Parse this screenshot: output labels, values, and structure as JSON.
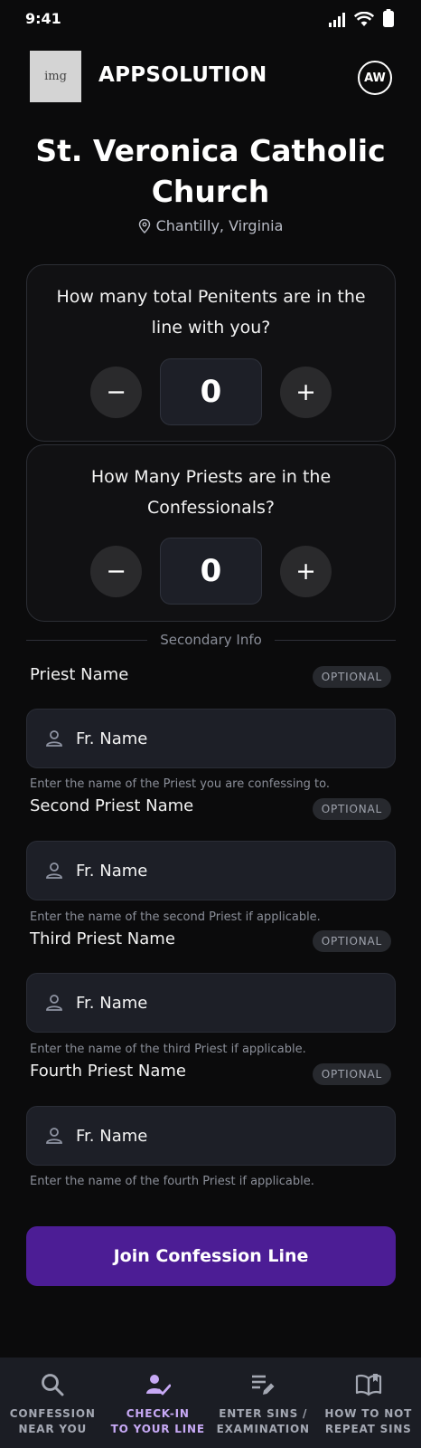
{
  "status_bar": {
    "time": "9:41"
  },
  "header": {
    "logo_text": "img",
    "app_name": "APPSOLUTION",
    "avatar_initials": "AW"
  },
  "church": {
    "name_line1": "St. Veronica Catholic",
    "name_line2": "Church",
    "location": "Chantilly, Virginia"
  },
  "penitents": {
    "question_line1": "How many total Penitents are in the",
    "question_line2": "line with you?",
    "value": "0",
    "minus": "−",
    "plus": "+"
  },
  "priests": {
    "question_line1": "How Many Priests are in the",
    "question_line2": "Confessionals?",
    "value": "0",
    "minus": "−",
    "plus": "+"
  },
  "secondary": {
    "label": "Secondary Info"
  },
  "fields": [
    {
      "label": "Priest Name",
      "badge": "OPTIONAL",
      "placeholder": "Fr. Name",
      "hint": "Enter the name of the Priest you are confessing to."
    },
    {
      "label": "Second Priest Name",
      "badge": "OPTIONAL",
      "placeholder": "Fr. Name",
      "hint": "Enter the name of the second Priest if applicable."
    },
    {
      "label": "Third Priest Name",
      "badge": "OPTIONAL",
      "placeholder": "Fr. Name",
      "hint": "Enter the name of the third Priest if applicable."
    },
    {
      "label": "Fourth Priest Name",
      "badge": "OPTIONAL",
      "placeholder": "Fr. Name",
      "hint": "Enter the name of the fourth Priest if applicable."
    }
  ],
  "join_button": "Join Confession Line",
  "nav": [
    {
      "line1": "CONFESSION",
      "line2": "NEAR YOU",
      "icon": "search-icon",
      "active": false
    },
    {
      "line1": "CHECK-IN",
      "line2": "TO YOUR LINE",
      "icon": "person-check-icon",
      "active": true
    },
    {
      "line1": "ENTER SINS /",
      "line2": "EXAMINATION",
      "icon": "list-edit-icon",
      "active": false
    },
    {
      "line1": "HOW TO NOT",
      "line2": "REPEAT SINS",
      "icon": "book-icon",
      "active": false
    }
  ],
  "colors": {
    "background": "#0b0b0c",
    "card": "#111113",
    "input": "#1d1f27",
    "accent": "#4c1d95",
    "active_nav": "#c7a9f5",
    "nav_bg": "#1b1d24"
  }
}
